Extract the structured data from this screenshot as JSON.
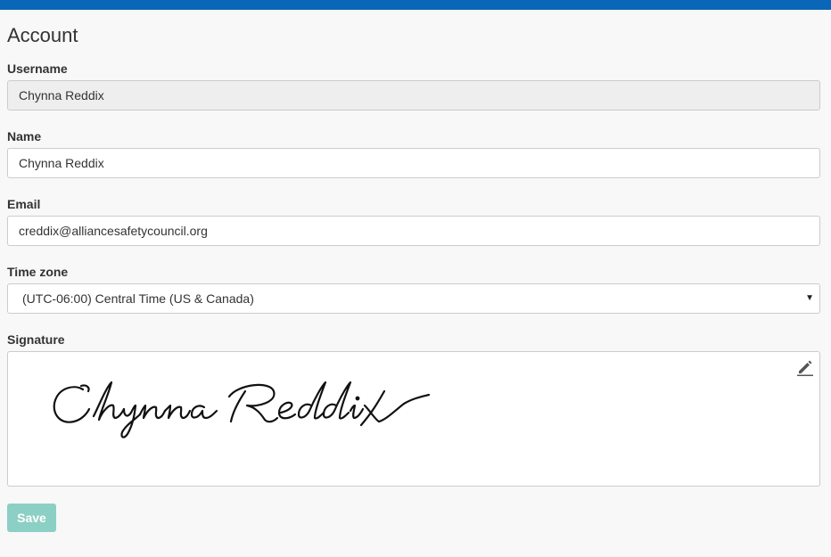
{
  "page": {
    "title": "Account"
  },
  "fields": {
    "username": {
      "label": "Username",
      "value": "Chynna Reddix"
    },
    "name": {
      "label": "Name",
      "value": "Chynna Reddix"
    },
    "email": {
      "label": "Email",
      "value": "creddix@alliancesafetycouncil.org"
    },
    "timezone": {
      "label": "Time zone",
      "value": "(UTC-06:00) Central Time (US & Canada)"
    },
    "signature": {
      "label": "Signature",
      "value": "Chynna Reddix",
      "edit_icon": "pencil-icon"
    }
  },
  "actions": {
    "save_label": "Save"
  },
  "colors": {
    "topbar": "#0a66b7",
    "save_button": "#8ccfc4"
  }
}
